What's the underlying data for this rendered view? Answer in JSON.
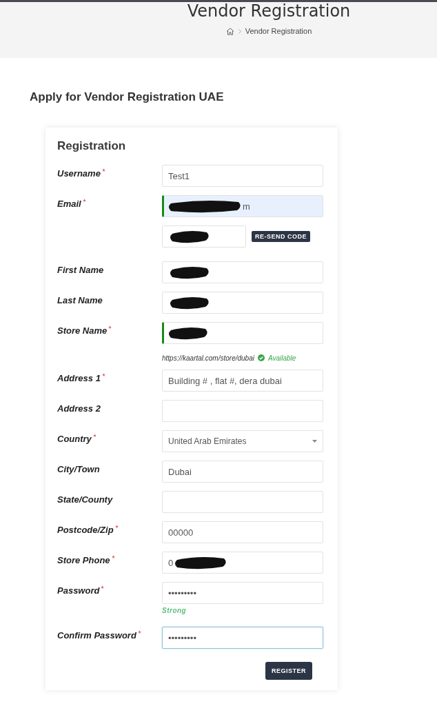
{
  "header": {
    "title": "Vendor Registration",
    "breadcrumb": "Vendor Registration"
  },
  "heading": "Apply for Vendor Registration UAE",
  "form": {
    "title": "Registration",
    "rows": [
      {
        "kind": "input",
        "label": "Username",
        "required": true,
        "value": "Test1"
      },
      {
        "kind": "input",
        "label": "Email",
        "required": true,
        "redacted": true,
        "value_after": "m",
        "valid": true,
        "autofilled": true
      },
      {
        "kind": "code",
        "redacted": true,
        "button": "RE-SEND CODE"
      },
      {
        "kind": "input",
        "label": "First Name",
        "required": false,
        "redacted": true
      },
      {
        "kind": "input",
        "label": "Last Name",
        "required": false,
        "redacted": true
      },
      {
        "kind": "input",
        "label": "Store Name",
        "required": true,
        "redacted": true,
        "valid": true
      },
      {
        "kind": "store-url",
        "url": "https://kaartal.com/store/dubai",
        "status": "Available"
      },
      {
        "kind": "input",
        "label": "Address 1",
        "required": true,
        "value": "Building # , flat #, dera dubai"
      },
      {
        "kind": "input",
        "label": "Address 2",
        "required": false
      },
      {
        "kind": "select",
        "label": "Country",
        "required": true,
        "value": "United Arab Emirates"
      },
      {
        "kind": "input",
        "label": "City/Town",
        "required": false,
        "value": "Dubai"
      },
      {
        "kind": "input",
        "label": "State/County",
        "required": false
      },
      {
        "kind": "input",
        "label": "Postcode/Zip",
        "required": true,
        "value": "00000"
      },
      {
        "kind": "input",
        "label": "Store Phone",
        "required": true,
        "value": "0",
        "redacted": true
      },
      {
        "kind": "input",
        "label": "Password",
        "required": true,
        "value": "•••••••••"
      },
      {
        "kind": "strength",
        "text": "Strong"
      },
      {
        "kind": "input",
        "label": "Confirm Password",
        "required": true,
        "value": "•••••••••",
        "focused": true
      }
    ],
    "submit": "REGISTER"
  }
}
